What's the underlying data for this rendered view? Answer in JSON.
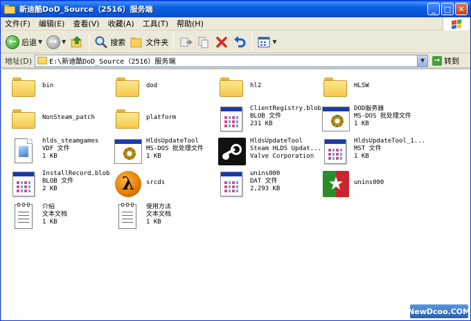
{
  "window": {
    "title": "新迪酷DoD_Source（2516）服务端"
  },
  "menubar": {
    "items": [
      "文件(F)",
      "编辑(E)",
      "查看(V)",
      "收藏(A)",
      "工具(T)",
      "帮助(H)"
    ]
  },
  "toolbar": {
    "back_label": "后退",
    "search_label": "搜索",
    "folders_label": "文件夹"
  },
  "address": {
    "label": "地址(D)",
    "path": "E:\\新迪酷DoD_Source（2516）服务端",
    "go_label": "转到"
  },
  "files": [
    {
      "name": "bin",
      "type": "",
      "size": "",
      "icon": "folder-icon"
    },
    {
      "name": "dod",
      "type": "",
      "size": "",
      "icon": "folder-icon"
    },
    {
      "name": "hl2",
      "type": "",
      "size": "",
      "icon": "folder-icon"
    },
    {
      "name": "HLSW",
      "type": "",
      "size": "",
      "icon": "folder-icon"
    },
    {
      "name": "NonSteam_patch",
      "type": "",
      "size": "",
      "icon": "folder-icon"
    },
    {
      "name": "platform",
      "type": "",
      "size": "",
      "icon": "folder-icon"
    },
    {
      "name": "ClientRegistry.blob",
      "type": "BLOB 文件",
      "size": "231 KB",
      "icon": "generic-file-icon"
    },
    {
      "name": "DOD服务器",
      "type": "MS-DOS 批处理文件",
      "size": "1 KB",
      "icon": "batch-file-icon"
    },
    {
      "name": "hlds_steamgames",
      "type": "VDF 文件",
      "size": "1 KB",
      "icon": "vdf-file-icon"
    },
    {
      "name": "HldsUpdateTool",
      "type": "MS-DOS 批处理文件",
      "size": "1 KB",
      "icon": "batch-file-icon"
    },
    {
      "name": "HldsUpdateTool",
      "type": "Steam HLDS Updat...",
      "size": "Valve Corporation",
      "icon": "steam-icon"
    },
    {
      "name": "HldsUpdateTool_1...",
      "type": "MST 文件",
      "size": "1 KB",
      "icon": "generic-file-icon"
    },
    {
      "name": "InstallRecord.blob",
      "type": "BLOB 文件",
      "size": "2 KB",
      "icon": "generic-file-icon"
    },
    {
      "name": "srcds",
      "type": "",
      "size": "",
      "icon": "half-life-icon"
    },
    {
      "name": "unins000",
      "type": "DAT 文件",
      "size": "2,293 KB",
      "icon": "generic-file-icon"
    },
    {
      "name": "unins000",
      "type": "",
      "size": "",
      "icon": "uninstaller-icon"
    },
    {
      "name": "介绍",
      "type": "文本文档",
      "size": "1 KB",
      "icon": "text-file-icon"
    },
    {
      "name": "使用方法",
      "type": "文本文档",
      "size": "1 KB",
      "icon": "text-file-icon"
    }
  ],
  "watermark": {
    "text": "NewDcoo.COM"
  }
}
